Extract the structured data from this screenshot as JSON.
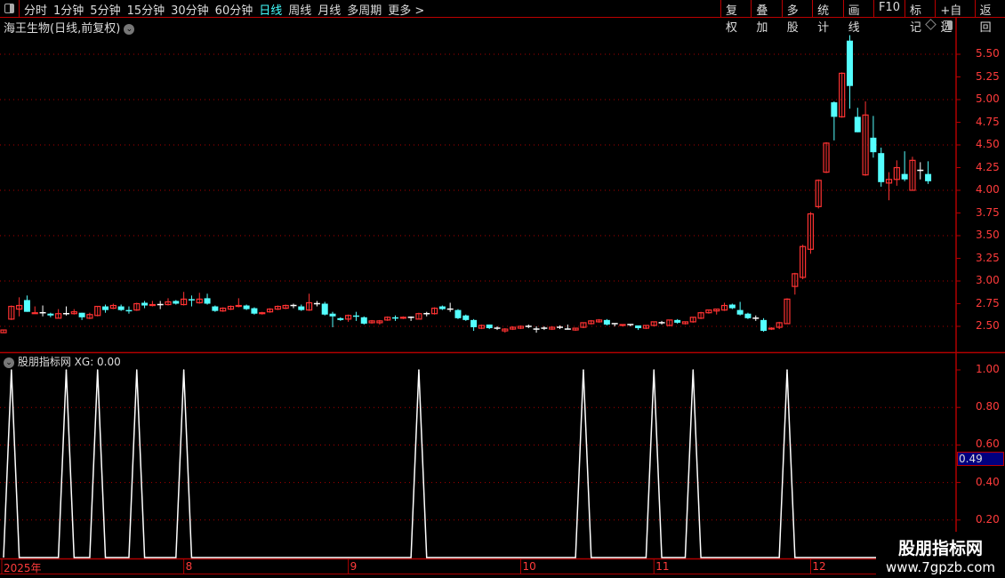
{
  "toolbar": {
    "periods": [
      "分时",
      "1分钟",
      "5分钟",
      "15分钟",
      "30分钟",
      "60分钟",
      "日线",
      "周线",
      "月线",
      "多周期",
      "更多 >"
    ],
    "active_period": "日线",
    "actions": [
      "复权",
      "叠加",
      "多股",
      "统计",
      "画线",
      "F10",
      "标记",
      "+自选",
      "返回"
    ]
  },
  "main": {
    "title": "海王生物(日线,前复权)"
  },
  "indicator": {
    "label": "股朋指标网",
    "readout": "XG: 0.00",
    "cursor_value": "0.49"
  },
  "watermark": {
    "line1": "股朋指标网",
    "line2": "www.7gpzb.com"
  },
  "colors": {
    "up": "#ff3232",
    "down": "#54ffff",
    "doji": "#ffffff",
    "axis": "#b00000",
    "indicator": "#ffffff"
  },
  "chart_data": [
    {
      "type": "candlestick",
      "title": "海王生物(日线,前复权)",
      "ylim": [
        2.4,
        5.75
      ],
      "yticks": [
        "5.50",
        "5.25",
        "5.00",
        "4.75",
        "4.50",
        "4.25",
        "4.00",
        "3.75",
        "3.50",
        "3.25",
        "3.00",
        "2.75",
        "2.50"
      ],
      "grid": true,
      "x_labels": [
        {
          "label": "2025年",
          "index": 0
        },
        {
          "label": "8",
          "index": 23
        },
        {
          "label": "9",
          "index": 44
        },
        {
          "label": "10",
          "index": 66
        },
        {
          "label": "11",
          "index": 83
        },
        {
          "label": "12",
          "index": 103
        }
      ],
      "ohlc": [
        [
          2.43,
          2.46,
          2.43,
          2.46
        ],
        [
          2.58,
          2.73,
          2.57,
          2.72
        ],
        [
          2.69,
          2.82,
          2.61,
          2.73
        ],
        [
          2.79,
          2.84,
          2.66,
          2.66
        ],
        [
          2.64,
          2.72,
          2.64,
          2.65
        ],
        [
          2.65,
          2.73,
          2.61,
          2.65
        ],
        [
          2.64,
          2.65,
          2.6,
          2.62
        ],
        [
          2.59,
          2.69,
          2.59,
          2.64
        ],
        [
          2.64,
          2.72,
          2.62,
          2.64
        ],
        [
          2.64,
          2.69,
          2.63,
          2.66
        ],
        [
          2.65,
          2.65,
          2.57,
          2.6
        ],
        [
          2.59,
          2.65,
          2.58,
          2.63
        ],
        [
          2.62,
          2.72,
          2.61,
          2.72
        ],
        [
          2.72,
          2.74,
          2.65,
          2.68
        ],
        [
          2.7,
          2.75,
          2.69,
          2.73
        ],
        [
          2.72,
          2.74,
          2.67,
          2.68
        ],
        [
          2.68,
          2.72,
          2.64,
          2.67
        ],
        [
          2.68,
          2.76,
          2.67,
          2.75
        ],
        [
          2.76,
          2.78,
          2.7,
          2.73
        ],
        [
          2.73,
          2.78,
          2.72,
          2.74
        ],
        [
          2.74,
          2.78,
          2.69,
          2.74
        ],
        [
          2.74,
          2.81,
          2.73,
          2.77
        ],
        [
          2.78,
          2.79,
          2.74,
          2.75
        ],
        [
          2.74,
          2.88,
          2.73,
          2.8
        ],
        [
          2.8,
          2.84,
          2.72,
          2.79
        ],
        [
          2.76,
          2.87,
          2.75,
          2.8
        ],
        [
          2.81,
          2.86,
          2.74,
          2.75
        ],
        [
          2.72,
          2.73,
          2.66,
          2.67
        ],
        [
          2.67,
          2.71,
          2.66,
          2.7
        ],
        [
          2.69,
          2.73,
          2.68,
          2.72
        ],
        [
          2.72,
          2.81,
          2.71,
          2.73
        ],
        [
          2.73,
          2.74,
          2.68,
          2.69
        ],
        [
          2.7,
          2.71,
          2.63,
          2.64
        ],
        [
          2.64,
          2.66,
          2.63,
          2.65
        ],
        [
          2.66,
          2.7,
          2.65,
          2.69
        ],
        [
          2.69,
          2.73,
          2.68,
          2.72
        ],
        [
          2.7,
          2.74,
          2.69,
          2.73
        ],
        [
          2.73,
          2.75,
          2.7,
          2.73
        ],
        [
          2.72,
          2.74,
          2.67,
          2.68
        ],
        [
          2.68,
          2.86,
          2.67,
          2.76
        ],
        [
          2.75,
          2.78,
          2.72,
          2.75
        ],
        [
          2.75,
          2.77,
          2.62,
          2.63
        ],
        [
          2.64,
          2.66,
          2.49,
          2.61
        ],
        [
          2.59,
          2.6,
          2.56,
          2.57
        ],
        [
          2.58,
          2.63,
          2.55,
          2.62
        ],
        [
          2.62,
          2.66,
          2.56,
          2.61
        ],
        [
          2.6,
          2.61,
          2.52,
          2.53
        ],
        [
          2.54,
          2.57,
          2.53,
          2.56
        ],
        [
          2.54,
          2.57,
          2.52,
          2.56
        ],
        [
          2.57,
          2.61,
          2.56,
          2.6
        ],
        [
          2.6,
          2.62,
          2.56,
          2.59
        ],
        [
          2.59,
          2.61,
          2.58,
          2.6
        ],
        [
          2.6,
          2.61,
          2.56,
          2.6
        ],
        [
          2.58,
          2.65,
          2.58,
          2.64
        ],
        [
          2.64,
          2.66,
          2.61,
          2.64
        ],
        [
          2.64,
          2.71,
          2.63,
          2.7
        ],
        [
          2.72,
          2.73,
          2.68,
          2.69
        ],
        [
          2.69,
          2.76,
          2.66,
          2.69
        ],
        [
          2.68,
          2.69,
          2.58,
          2.59
        ],
        [
          2.62,
          2.63,
          2.56,
          2.57
        ],
        [
          2.57,
          2.58,
          2.45,
          2.49
        ],
        [
          2.48,
          2.52,
          2.47,
          2.51
        ],
        [
          2.52,
          2.52,
          2.47,
          2.48
        ],
        [
          2.48,
          2.5,
          2.46,
          2.48
        ],
        [
          2.45,
          2.48,
          2.43,
          2.47
        ],
        [
          2.47,
          2.5,
          2.46,
          2.49
        ],
        [
          2.48,
          2.51,
          2.47,
          2.5
        ],
        [
          2.5,
          2.52,
          2.48,
          2.5
        ],
        [
          2.47,
          2.5,
          2.43,
          2.47
        ],
        [
          2.48,
          2.5,
          2.46,
          2.48
        ],
        [
          2.47,
          2.5,
          2.46,
          2.49
        ],
        [
          2.49,
          2.51,
          2.47,
          2.49
        ],
        [
          2.47,
          2.52,
          2.47,
          2.47
        ],
        [
          2.46,
          2.48,
          2.45,
          2.48
        ],
        [
          2.49,
          2.54,
          2.48,
          2.54
        ],
        [
          2.53,
          2.57,
          2.52,
          2.56
        ],
        [
          2.55,
          2.58,
          2.54,
          2.57
        ],
        [
          2.57,
          2.58,
          2.51,
          2.52
        ],
        [
          2.53,
          2.53,
          2.5,
          2.53
        ],
        [
          2.51,
          2.52,
          2.5,
          2.52
        ],
        [
          2.52,
          2.52,
          2.5,
          2.52
        ],
        [
          2.51,
          2.51,
          2.46,
          2.48
        ],
        [
          2.48,
          2.51,
          2.47,
          2.51
        ],
        [
          2.51,
          2.55,
          2.5,
          2.55
        ],
        [
          2.54,
          2.56,
          2.52,
          2.54
        ],
        [
          2.51,
          2.57,
          2.5,
          2.57
        ],
        [
          2.57,
          2.58,
          2.53,
          2.54
        ],
        [
          2.53,
          2.55,
          2.52,
          2.55
        ],
        [
          2.55,
          2.6,
          2.54,
          2.6
        ],
        [
          2.59,
          2.66,
          2.58,
          2.65
        ],
        [
          2.65,
          2.68,
          2.64,
          2.68
        ],
        [
          2.67,
          2.69,
          2.63,
          2.69
        ],
        [
          2.68,
          2.76,
          2.67,
          2.73
        ],
        [
          2.74,
          2.75,
          2.69,
          2.7
        ],
        [
          2.68,
          2.77,
          2.62,
          2.63
        ],
        [
          2.64,
          2.65,
          2.58,
          2.59
        ],
        [
          2.59,
          2.62,
          2.56,
          2.59
        ],
        [
          2.57,
          2.59,
          2.44,
          2.45
        ],
        [
          2.47,
          2.49,
          2.46,
          2.48
        ],
        [
          2.49,
          2.55,
          2.47,
          2.54
        ],
        [
          2.53,
          2.81,
          2.53,
          2.8
        ],
        [
          2.94,
          3.09,
          2.85,
          3.08
        ],
        [
          3.04,
          3.4,
          3.02,
          3.38
        ],
        [
          3.35,
          3.76,
          3.3,
          3.74
        ],
        [
          3.82,
          4.12,
          3.8,
          4.11
        ],
        [
          4.2,
          4.53,
          4.19,
          4.52
        ],
        [
          4.97,
          4.98,
          4.55,
          4.81
        ],
        [
          4.81,
          5.3,
          4.8,
          5.29
        ],
        [
          5.65,
          5.71,
          4.9,
          5.15
        ],
        [
          4.81,
          4.91,
          4.64,
          4.64
        ],
        [
          4.17,
          4.98,
          4.16,
          4.83
        ],
        [
          4.58,
          4.82,
          4.36,
          4.42
        ],
        [
          4.41,
          4.47,
          4.04,
          4.09
        ],
        [
          4.08,
          4.2,
          3.89,
          4.12
        ],
        [
          4.12,
          4.33,
          4.05,
          4.25
        ],
        [
          4.18,
          4.43,
          4.1,
          4.12
        ],
        [
          4.0,
          4.37,
          4.0,
          4.33
        ],
        [
          4.22,
          4.31,
          4.12,
          4.22
        ],
        [
          4.18,
          4.32,
          4.07,
          4.1
        ]
      ]
    },
    {
      "type": "line",
      "title": "股朋指标网",
      "series": [
        {
          "name": "XG",
          "signal_indices": [
            1,
            8,
            12,
            17,
            23,
            53,
            74,
            83,
            88,
            100
          ],
          "signal_value": 1,
          "base_value": 0
        }
      ],
      "ylim": [
        0,
        1.05
      ],
      "yticks": [
        "1.00",
        "0.80",
        "0.60",
        "0.40",
        "0.20"
      ],
      "grid": true
    }
  ]
}
